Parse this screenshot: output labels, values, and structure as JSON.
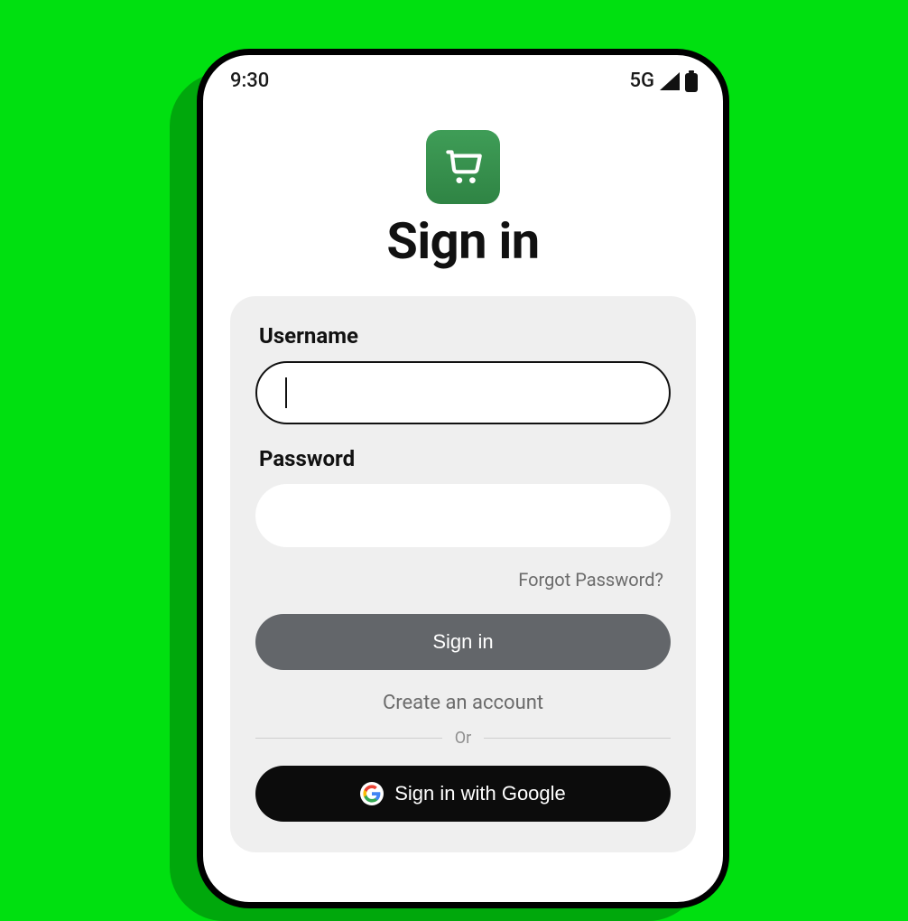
{
  "statusbar": {
    "time": "9:30",
    "network": "5G"
  },
  "app": {
    "title": "Sign in",
    "logo_icon": "shopping-cart"
  },
  "form": {
    "username_label": "Username",
    "username_value": "",
    "password_label": "Password",
    "password_value": "",
    "forgot_label": "Forgot Password?",
    "signin_label": "Sign in",
    "create_account_label": "Create an account",
    "divider_label": "Or",
    "google_label": "Sign in with Google"
  },
  "colors": {
    "background": "#00e010",
    "logo_bg": "#3f9d57",
    "card_bg": "#efefef",
    "primary_btn": "#63666a",
    "google_btn": "#0c0c0c"
  }
}
